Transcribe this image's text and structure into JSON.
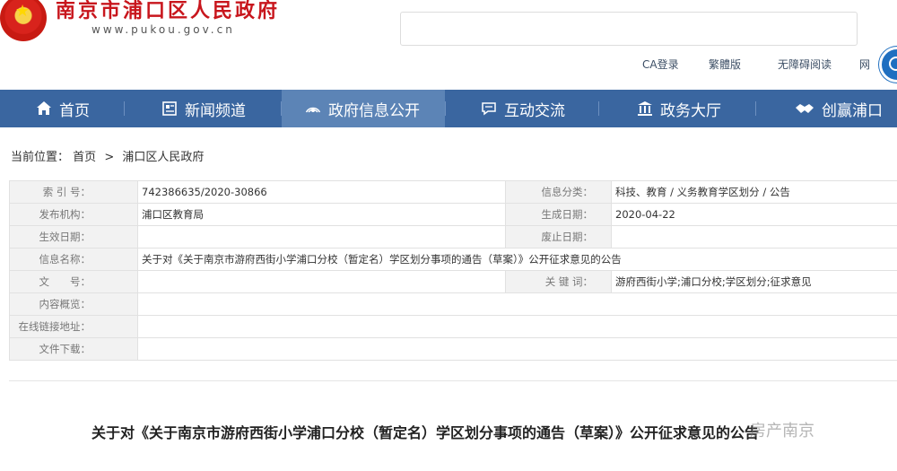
{
  "header": {
    "site_title": "南京市浦口区人民政府",
    "site_url": "www.pukou.gov.cn",
    "search_value": "",
    "links": [
      "CA登录",
      "繁體版",
      "无障碍阅读",
      "网"
    ]
  },
  "nav": {
    "items": [
      {
        "label": "首页",
        "icon": "home-icon"
      },
      {
        "label": "新闻频道",
        "icon": "news-icon"
      },
      {
        "label": "政府信息公开",
        "icon": "broadcast-icon"
      },
      {
        "label": "互动交流",
        "icon": "chat-icon"
      },
      {
        "label": "政务大厅",
        "icon": "hall-icon"
      },
      {
        "label": "创赢浦口",
        "icon": "handshake-icon"
      }
    ],
    "active": "政府信息公开"
  },
  "breadcrumb": {
    "prefix": "当前位置：",
    "items": [
      "首页",
      "浦口区人民政府"
    ],
    "separator": ">"
  },
  "info": {
    "index_label": "索 引 号：",
    "index_value": "742386635/2020-30866",
    "category_label": "信息分类：",
    "category_value": "科技、教育 / 义务教育学区划分 / 公告",
    "publisher_label": "发布机构：",
    "publisher_value": "浦口区教育局",
    "created_label": "生成日期：",
    "created_value": "2020-04-22",
    "effective_label": "生效日期：",
    "effective_value": "",
    "repeal_label": "废止日期：",
    "repeal_value": "",
    "name_label": "信息名称：",
    "name_value": "关于对《关于南京市游府西街小学浦口分校（暂定名）学区划分事项的通告（草案）》公开征求意见的公告",
    "doc_no_label": "文　　号：",
    "doc_no_value": "",
    "keywords_label": "关 键 词：",
    "keywords_value": "游府西街小学;浦口分校;学区划分;征求意见",
    "summary_label": "内容概览：",
    "summary_value": "",
    "link_label": "在线链接地址：",
    "link_value": "",
    "download_label": "文件下载：",
    "download_value": ""
  },
  "article": {
    "title": "关于对《关于南京市游府西街小学浦口分校（暂定名）学区划分事项的通告（草案）》公开征求意见的公告"
  },
  "watermark": "房产南京",
  "colors": {
    "nav_bg": "#3a66a0",
    "nav_active": "#5c84b6",
    "title_red": "#c8161d"
  }
}
